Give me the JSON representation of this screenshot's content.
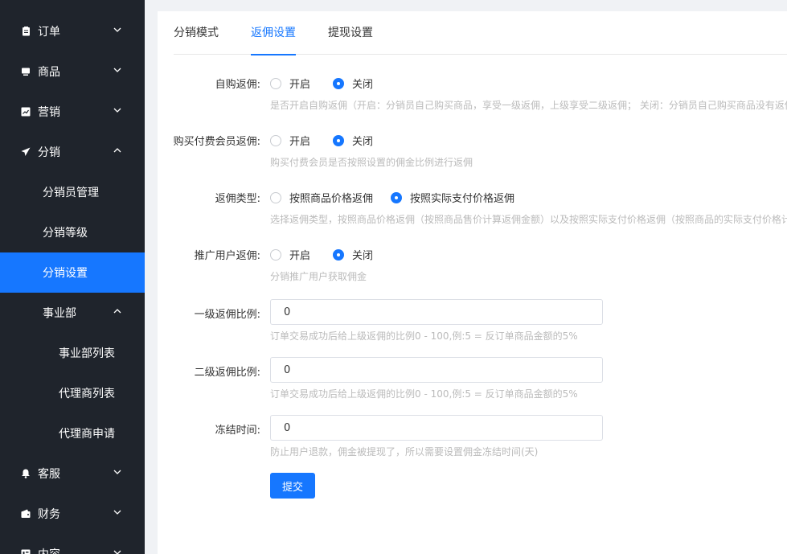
{
  "sidebar": {
    "items": [
      {
        "label": "订单",
        "icon": "clipboard-icon"
      },
      {
        "label": "商品",
        "icon": "goods-icon"
      },
      {
        "label": "营销",
        "icon": "chart-icon"
      },
      {
        "label": "分销",
        "icon": "paper-plane-icon"
      },
      {
        "label": "分销员管理"
      },
      {
        "label": "分销等级"
      },
      {
        "label": "分销设置"
      },
      {
        "label": "事业部"
      },
      {
        "label": "事业部列表"
      },
      {
        "label": "代理商列表"
      },
      {
        "label": "代理商申请"
      },
      {
        "label": "客服",
        "icon": "bell-icon"
      },
      {
        "label": "财务",
        "icon": "wallet-icon"
      },
      {
        "label": "内容",
        "icon": "content-icon"
      }
    ]
  },
  "tabs": [
    "分销模式",
    "返佣设置",
    "提现设置"
  ],
  "form": {
    "self_purchase": {
      "label": "自购返佣:",
      "options": [
        "开启",
        "关闭"
      ],
      "selected": "关闭",
      "help": "是否开启自购返佣（开启：分销员自己购买商品，享受一级返佣，上级享受二级返佣； 关闭：分销员自己购买商品没有返佣"
    },
    "member_purchase": {
      "label": "购买付费会员返佣:",
      "options": [
        "开启",
        "关闭"
      ],
      "selected": "关闭",
      "help": "购买付费会员是否按照设置的佣金比例进行返佣"
    },
    "commission_type": {
      "label": "返佣类型:",
      "options": [
        "按照商品价格返佣",
        "按照实际支付价格返佣"
      ],
      "selected": "按照实际支付价格返佣",
      "help": "选择返佣类型，按照商品价格返佣（按照商品售价计算返佣金额）以及按照实际支付价格返佣（按照商品的实际支付价格计"
    },
    "promotion": {
      "label": "推广用户返佣:",
      "options": [
        "开启",
        "关闭"
      ],
      "selected": "关闭",
      "help": "分销推广用户获取佣金"
    },
    "level1": {
      "label": "一级返佣比例:",
      "value": "0",
      "help": "订单交易成功后给上级返佣的比例0 - 100,例:5 = 反订单商品金额的5%"
    },
    "level2": {
      "label": "二级返佣比例:",
      "value": "0",
      "help": "订单交易成功后给上级返佣的比例0 - 100,例:5 = 反订单商品金额的5%"
    },
    "freeze": {
      "label": "冻结时间:",
      "value": "0",
      "help": "防止用户退款，佣金被提现了，所以需要设置佣金冻结时间(天)"
    },
    "submit_label": "提交"
  },
  "colors": {
    "accent": "#1677ff",
    "sidebar": "#1f242c"
  }
}
